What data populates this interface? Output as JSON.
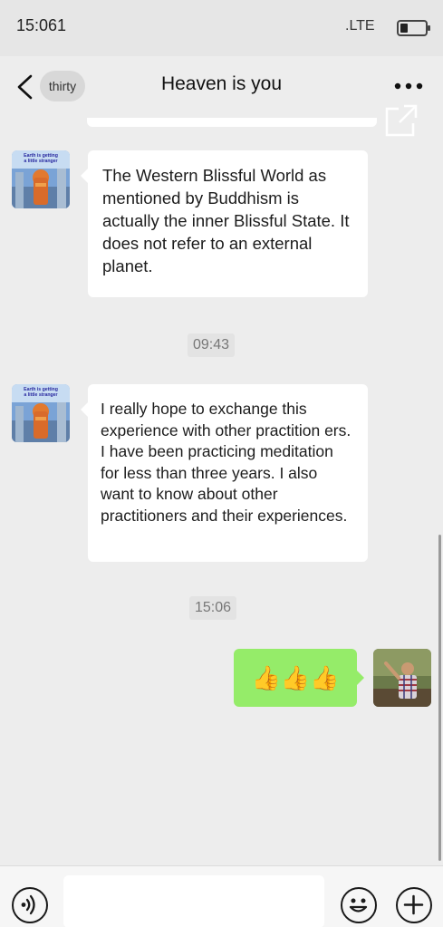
{
  "status_bar": {
    "time": "15:061",
    "network": ".LTE"
  },
  "nav": {
    "unread_label": "thirty",
    "title": "Heaven is you"
  },
  "messages": [
    {
      "side": "left",
      "avatar_caption": "Earth is getting a little stranger",
      "text": "The Western Blissful World as mentioned by Buddhism is actually the inner Blissful State. It does not refer to an external planet."
    },
    {
      "side": "left",
      "avatar_caption": "Earth is getting a little stranger",
      "text": "I really hope to exchange this experience with other practition ers. I have been practicing meditation for less than three years. I also want to know about other practitioners and their experiences."
    },
    {
      "side": "right",
      "text": "👍👍👍"
    }
  ],
  "timestamps": [
    "09:43",
    "15:06"
  ],
  "icons": {
    "back": "chevron-left-icon",
    "more": "more-dots-icon",
    "share": "share-external-icon",
    "voice": "voice-icon",
    "emoji": "emoji-icon",
    "plus": "plus-icon"
  },
  "colors": {
    "background": "#ededed",
    "sent_bubble": "#95ec69",
    "received_bubble": "#ffffff"
  }
}
